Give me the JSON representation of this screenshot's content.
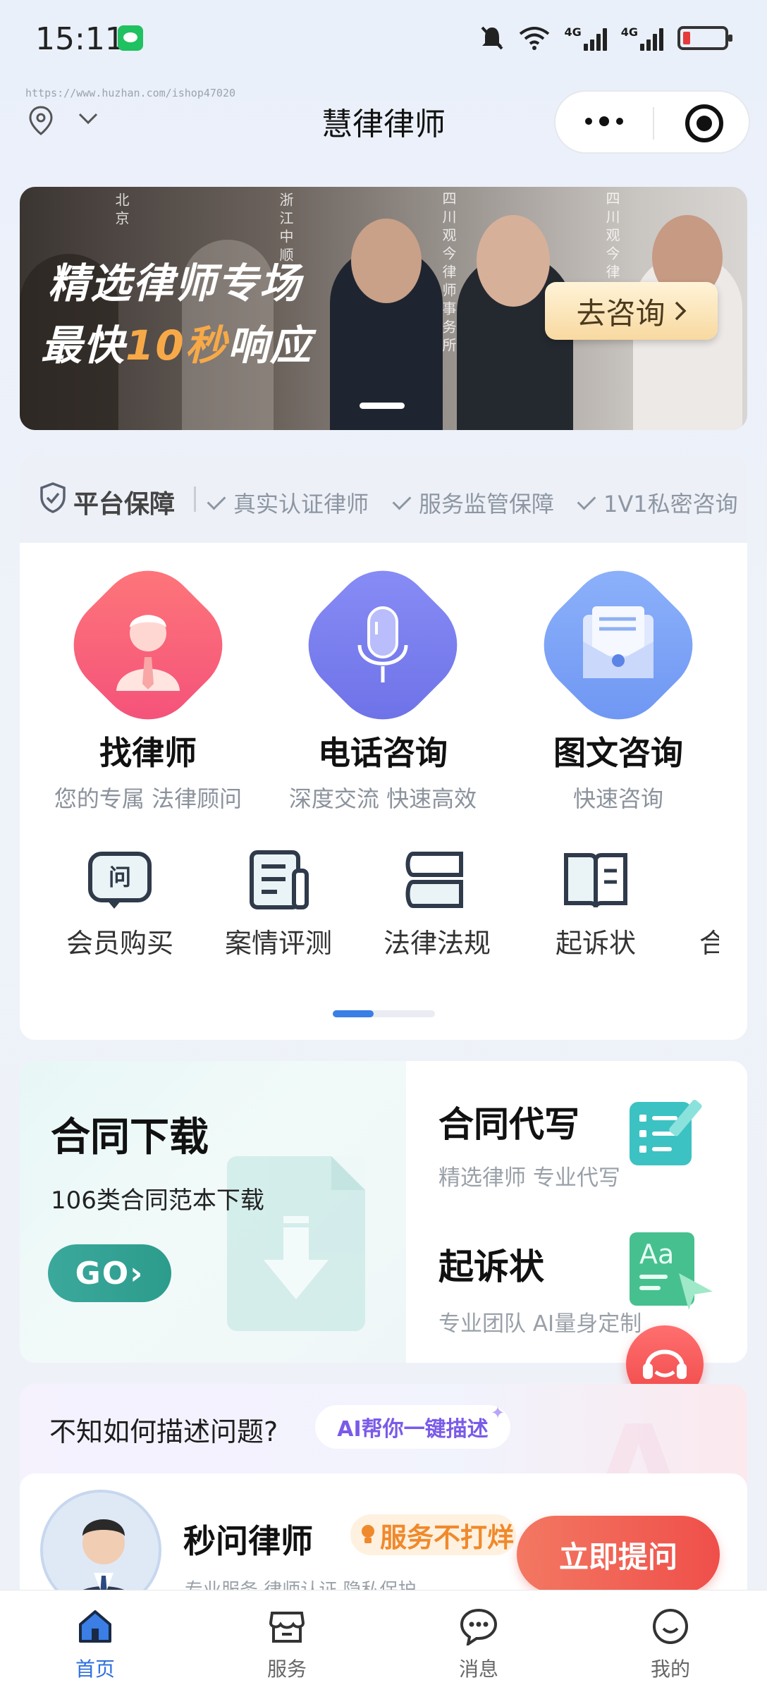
{
  "status_bar": {
    "time": "15:11",
    "network1": "4G",
    "network2": "4G"
  },
  "header": {
    "watermark": "https://www.huzhan.com/ishop47020",
    "title": "慧律律师"
  },
  "banner": {
    "line1": "精选律师专场",
    "line2_prefix": "最快",
    "line2_highlight": "10秒",
    "line2_suffix": "响应",
    "button": "去咨询",
    "background_texts": [
      "北京",
      "浙江中顺",
      "四川观今律师事务所",
      "四川观今律"
    ]
  },
  "guarantee": {
    "title": "平台保障",
    "items": [
      "真实认证律师",
      "服务监管保障",
      "1V1私密咨询"
    ]
  },
  "services": [
    {
      "name": "找律师",
      "sub": "您的专属 法律顾问",
      "icon": "lawyer-icon"
    },
    {
      "name": "电话咨询",
      "sub": "深度交流 快速高效",
      "icon": "microphone-icon"
    },
    {
      "name": "图文咨询",
      "sub": "快速咨询",
      "icon": "envelope-icon"
    }
  ],
  "tools": [
    {
      "label": "会员购买",
      "icon": "question-badge-icon",
      "icon_text": "问"
    },
    {
      "label": "案情评测",
      "icon": "document-icon"
    },
    {
      "label": "法律法规",
      "icon": "books-icon"
    },
    {
      "label": "起诉状",
      "icon": "open-book-icon"
    },
    {
      "label": "合",
      "icon": ""
    }
  ],
  "contract": {
    "download_title": "合同下载",
    "download_sub": "106类合同范本下载",
    "go_label": "GO›",
    "draft_title": "合同代写",
    "draft_sub": "精选律师 专业代写",
    "complaint_title": "起诉状",
    "complaint_sub": "专业团队 AI量身定制",
    "aa_text": "Aa"
  },
  "ai": {
    "question": "不知如何描述问题?",
    "pill": "AI帮你一键描述",
    "name": "秒问律师",
    "badge": "服务不打烊",
    "tags": "专业服务  律师认证  隐私保护",
    "ask_button": "立即提问"
  },
  "tabs": [
    {
      "label": "首页",
      "icon": "home-icon",
      "active": true
    },
    {
      "label": "服务",
      "icon": "store-icon",
      "active": false
    },
    {
      "label": "消息",
      "icon": "chat-icon",
      "active": false
    },
    {
      "label": "我的",
      "icon": "smile-icon",
      "active": false
    }
  ],
  "colors": {
    "accent": "#2f6fe0",
    "teal": "#2c9c8c",
    "orange_highlight": "#f7a948",
    "ask_red": "#ef4f4a"
  }
}
